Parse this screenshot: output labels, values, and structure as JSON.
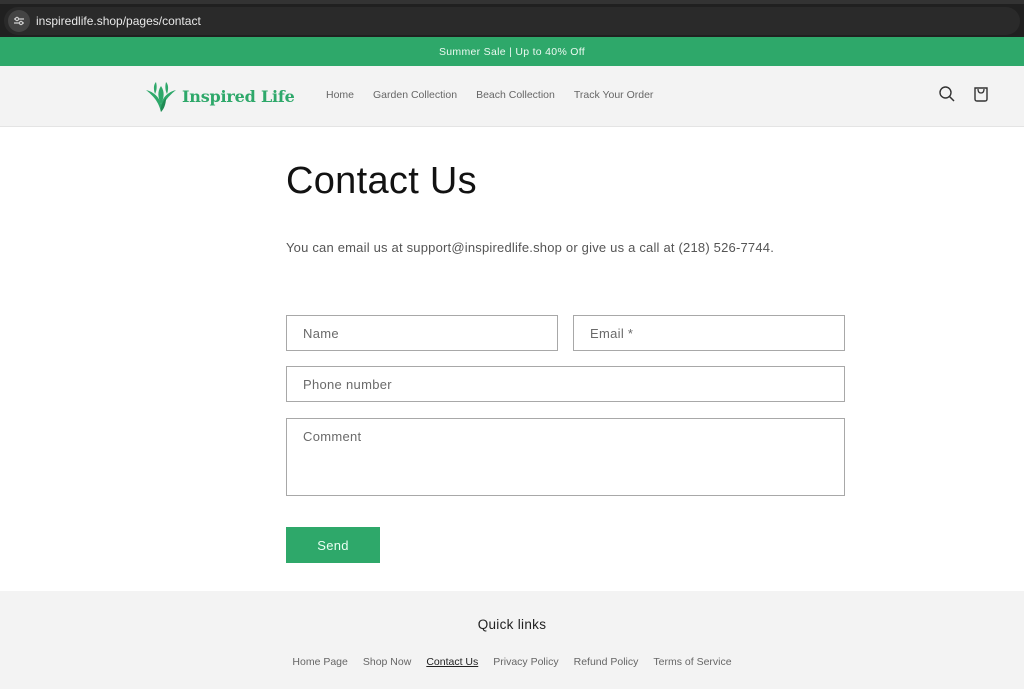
{
  "browser": {
    "url": "inspiredlife.shop/pages/contact",
    "site_icon": "site-settings-icon"
  },
  "announcement": {
    "text": "Summer Sale | Up to 40% Off"
  },
  "header": {
    "logo_text": "Inspired Life",
    "nav": [
      {
        "label": "Home"
      },
      {
        "label": "Garden Collection"
      },
      {
        "label": "Beach Collection"
      },
      {
        "label": "Track Your Order"
      }
    ],
    "icons": [
      "search-icon",
      "cart-icon"
    ]
  },
  "main": {
    "title": "Contact Us",
    "intro": "You can email us at support@inspiredlife.shop or give us a call at (218) 526-7744.",
    "form": {
      "name_placeholder": "Name",
      "email_placeholder": "Email *",
      "phone_placeholder": "Phone number",
      "comment_placeholder": "Comment",
      "send_label": "Send"
    }
  },
  "footer": {
    "heading": "Quick links",
    "links": [
      {
        "label": "Home Page"
      },
      {
        "label": "Shop Now"
      },
      {
        "label": "Contact Us",
        "active": true
      },
      {
        "label": "Privacy Policy"
      },
      {
        "label": "Refund Policy"
      },
      {
        "label": "Terms of Service"
      }
    ]
  },
  "colors": {
    "brand_green": "#2ea86a"
  }
}
